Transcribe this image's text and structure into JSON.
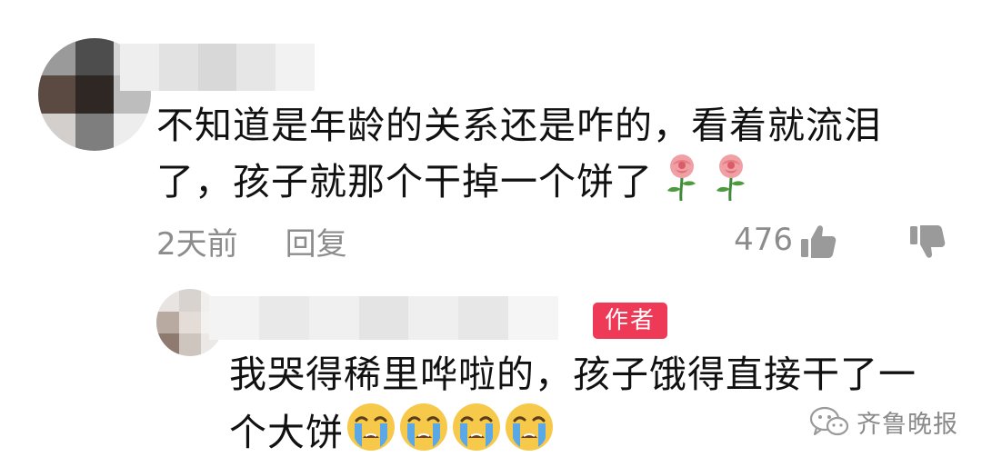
{
  "comment_main": {
    "text": "不知道是年龄的关系还是咋的，看着就流泪了，孩子就那个干掉一个饼了",
    "emojis": [
      "rose-icon",
      "rose-icon"
    ],
    "time": "2天前",
    "reply_label": "回复",
    "likes": "476"
  },
  "author_reply": {
    "badge": "作者",
    "text": "我哭得稀里哗啦的，孩子饿得直接干了一个大饼",
    "emojis": [
      "crying-face-icon",
      "crying-face-icon",
      "crying-face-icon",
      "crying-face-icon"
    ]
  },
  "watermark": {
    "text": "齐鲁晚报"
  },
  "colors": {
    "badge_red": "#ee3a57",
    "meta_gray": "#8c8c8c",
    "text_dark": "#111111"
  }
}
